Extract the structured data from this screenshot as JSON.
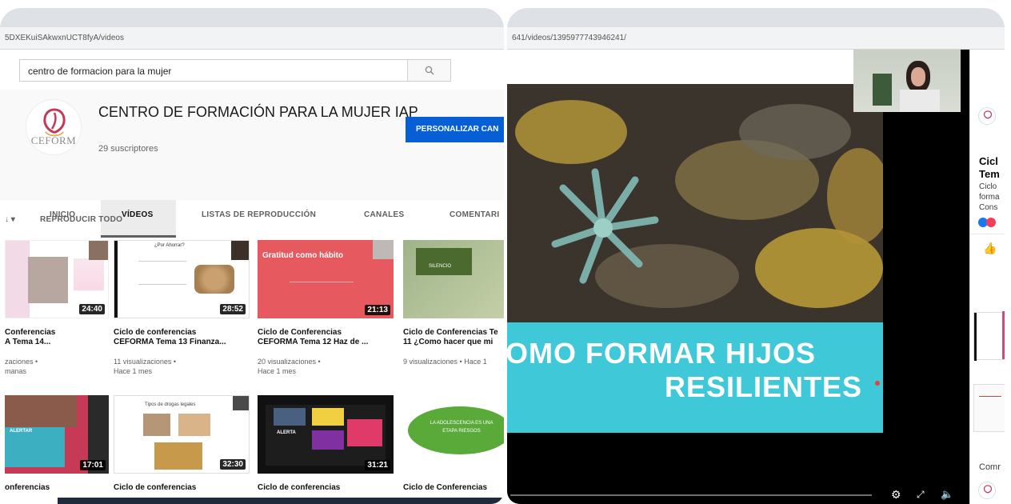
{
  "left_window": {
    "url": "5DXEKuiSAkwxnUCT8fyA/videos",
    "search": {
      "value": "centro de formacion para la mujer"
    },
    "channel": {
      "logo_text": "CEFORM",
      "title": "CENTRO DE FORMACIÓN PARA LA MUJER IAP",
      "subscribers": "29 suscriptores",
      "customize_button": "PERSONALIZAR CAN"
    },
    "tabs": [
      "INICIO",
      "VÍDEOS",
      "LISTAS DE REPRODUCCIÓN",
      "CANALES",
      "COMENTARI"
    ],
    "active_tab": 1,
    "sort_label": "↓ ▾",
    "play_all": "REPRODUCIR TODO",
    "videos_row1": [
      {
        "duration": "24:40",
        "title1": "Conferencias",
        "title2": "A Tema 14...",
        "meta1": "zaciones •",
        "meta2": "manas"
      },
      {
        "duration": "28:52",
        "title1": "Ciclo de conferencias",
        "title2": "CEFORMA Tema 13 Finanza...",
        "meta1": "11 visualizaciones •",
        "meta2": "Hace 1 mes",
        "thumb_heading": "¿Por Ahorrar?"
      },
      {
        "duration": "21:13",
        "title1": "Ciclo de Conferencias",
        "title2": "CEFORMA Tema 12 Haz de ...",
        "meta1": "20 visualizaciones •",
        "meta2": "Hace 1 mes",
        "thumb_heading": "Gratitud como hábito"
      },
      {
        "duration": "",
        "title1": "Ciclo de Conferencias Te",
        "title2": "11 ¿Como hacer que mi",
        "meta1": "9 visualizaciones • Hace 1",
        "meta2": "",
        "thumb_heading": "SILENCIO"
      }
    ],
    "videos_row2": [
      {
        "duration": "17:01",
        "title1": "onferencias",
        "thumb_heading": "ALERTAR"
      },
      {
        "duration": "32:30",
        "title1": "Ciclo de conferencias",
        "thumb_heading": "Tipos de drogas legales"
      },
      {
        "duration": "31:21",
        "title1": "Ciclo de conferencias",
        "thumb_heading": "ALERTA"
      },
      {
        "duration": "",
        "title1": "Ciclo de Conferencias",
        "thumb_heading": "LA ADOLESCENCIA ES UNA ETAPA RIESGOS"
      }
    ]
  },
  "right_window": {
    "url": "641/videos/1395977743946241/",
    "slide": {
      "banner_line1": "OMO FORMAR HIJOS",
      "banner_line2": "RESILIENTES"
    },
    "sidebar": {
      "title1": "Cicl",
      "title2": "Tem",
      "desc": [
        "Ciclo",
        "forma",
        "Cons"
      ],
      "comments_label": "Comr"
    }
  },
  "colors": {
    "customize_blue": "#065fd4",
    "banner_cyan": "#3fc8d8",
    "video_black": "#000000"
  }
}
